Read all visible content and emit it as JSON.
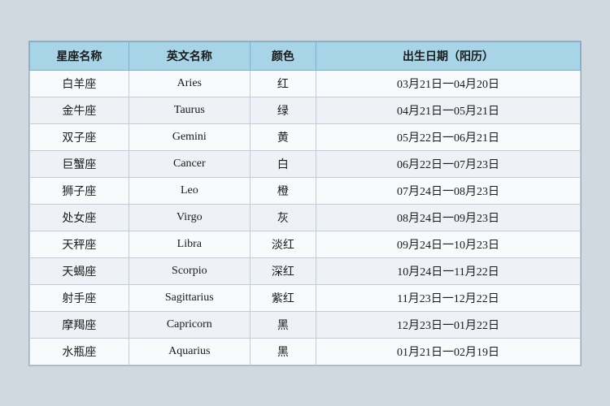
{
  "table": {
    "headers": [
      {
        "key": "chinese_name",
        "label": "星座名称"
      },
      {
        "key": "english_name",
        "label": "英文名称"
      },
      {
        "key": "color",
        "label": "颜色"
      },
      {
        "key": "date_range",
        "label": "出生日期（阳历）"
      }
    ],
    "rows": [
      {
        "chinese": "白羊座",
        "english": "Aries",
        "color": "红",
        "dates": "03月21日一04月20日"
      },
      {
        "chinese": "金牛座",
        "english": "Taurus",
        "color": "绿",
        "dates": "04月21日一05月21日"
      },
      {
        "chinese": "双子座",
        "english": "Gemini",
        "color": "黄",
        "dates": "05月22日一06月21日"
      },
      {
        "chinese": "巨蟹座",
        "english": "Cancer",
        "color": "白",
        "dates": "06月22日一07月23日"
      },
      {
        "chinese": "狮子座",
        "english": "Leo",
        "color": "橙",
        "dates": "07月24日一08月23日"
      },
      {
        "chinese": "处女座",
        "english": "Virgo",
        "color": "灰",
        "dates": "08月24日一09月23日"
      },
      {
        "chinese": "天秤座",
        "english": "Libra",
        "color": "淡红",
        "dates": "09月24日一10月23日"
      },
      {
        "chinese": "天蝎座",
        "english": "Scorpio",
        "color": "深红",
        "dates": "10月24日一11月22日"
      },
      {
        "chinese": "射手座",
        "english": "Sagittarius",
        "color": "紫红",
        "dates": "11月23日一12月22日"
      },
      {
        "chinese": "摩羯座",
        "english": "Capricorn",
        "color": "黑",
        "dates": "12月23日一01月22日"
      },
      {
        "chinese": "水瓶座",
        "english": "Aquarius",
        "color": "黑",
        "dates": "01月21日一02月19日"
      }
    ]
  }
}
